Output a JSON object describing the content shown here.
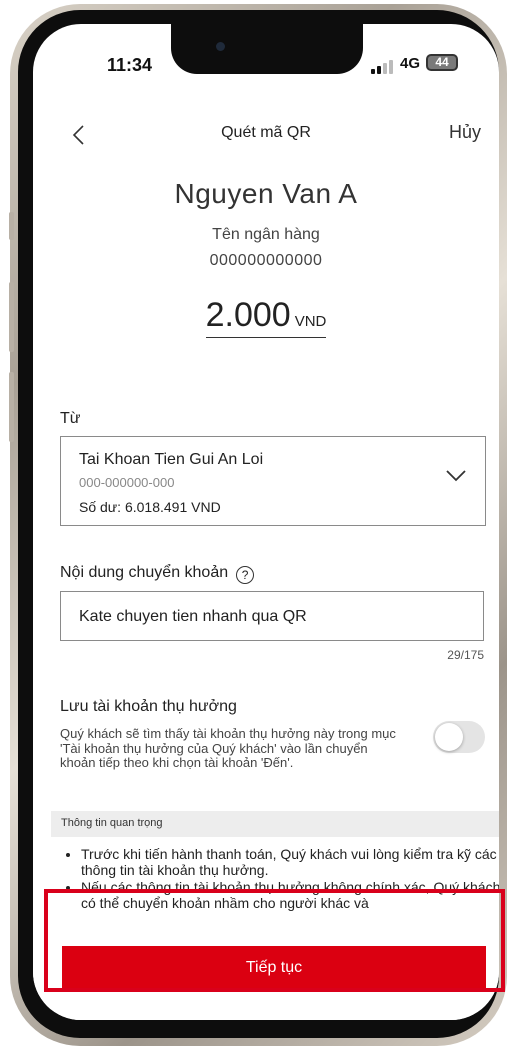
{
  "status_bar": {
    "time": "11:34",
    "network": "4G",
    "battery": "44"
  },
  "nav": {
    "title": "Quét mã QR",
    "cancel_label": "Hủy"
  },
  "recipient": {
    "name": "Nguyen Van A",
    "bank": "Tên ngân hàng",
    "account_number": "000000000000"
  },
  "amount": {
    "value": "2.000",
    "currency": "VND"
  },
  "from": {
    "label": "Từ",
    "account_name": "Tai Khoan Tien Gui An Loi",
    "account_number": "000-000000-000",
    "balance": "Số dư: 6.018.491 VND"
  },
  "transfer_content": {
    "label": "Nội dung chuyển khoản",
    "value": "Kate chuyen tien nhanh qua QR",
    "char_count": "29/175"
  },
  "save_beneficiary": {
    "title": "Lưu tài khoản thụ hưởng",
    "description": "Quý khách sẽ tìm thấy tài khoản thụ hưởng này trong mục 'Tài khoản thụ hưởng của Quý khách' vào lần chuyển khoản tiếp theo khi chọn tài khoản 'Đến'.",
    "enabled": false
  },
  "important_info": {
    "header": "Thông tin quan trọng",
    "items": [
      "Trước khi tiến hành thanh toán, Quý khách vui lòng kiểm tra kỹ các thông tin tài khoản thụ hưởng.",
      "Nếu các thông tin tài khoản thụ hưởng không chính xác, Quý khách có thể chuyển khoản nhầm cho người khác và"
    ]
  },
  "continue_label": "Tiếp tục",
  "colors": {
    "brand_red": "#db0011",
    "highlight": "#d9001b"
  }
}
